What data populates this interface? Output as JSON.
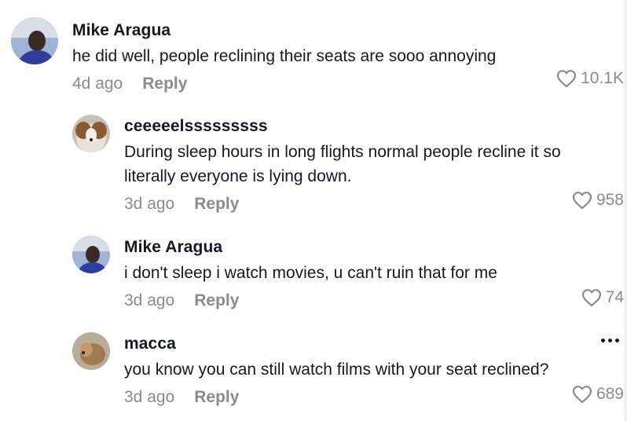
{
  "comments": [
    {
      "username": "Mike Aragua",
      "text": "he did well, people reclining their seats are sooo annoying",
      "time": "4d ago",
      "reply_label": "Reply",
      "likes": "10.1K"
    },
    {
      "username": "ceeeeelsssssssss",
      "text_line1": "During sleep hours in long flights normal people recline it so",
      "text_line2": "literally everyone is lying down.",
      "time": "3d ago",
      "reply_label": "Reply",
      "likes": "958"
    },
    {
      "username": "Mike Aragua",
      "text": "i don't sleep i watch movies, u can't ruin that for me",
      "time": "3d ago",
      "reply_label": "Reply",
      "likes": "74"
    },
    {
      "username": "macca",
      "text": "you know you can still watch films with your seat reclined?",
      "time": "3d ago",
      "reply_label": "Reply",
      "likes": "689"
    }
  ],
  "icons": {
    "like": "heart-outline-icon",
    "more": "more-horizontal-icon"
  },
  "colors": {
    "text": "#161823",
    "secondary": "#8a8b91",
    "background": "#ffffff"
  }
}
